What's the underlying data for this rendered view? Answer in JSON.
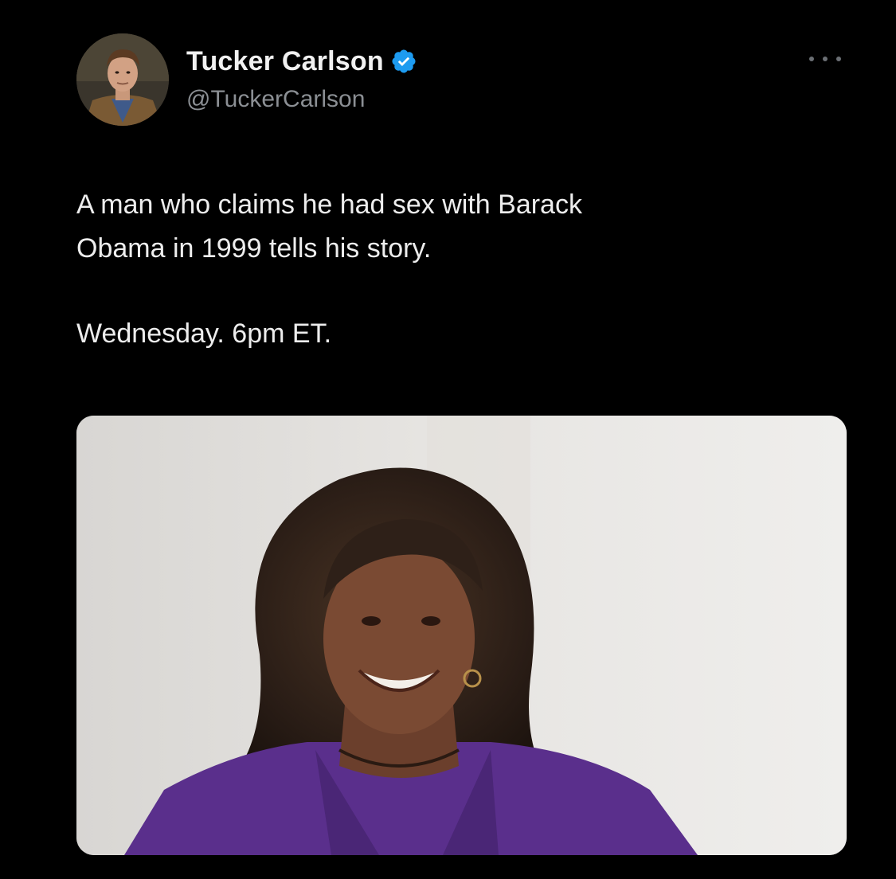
{
  "tweet": {
    "author": {
      "name": "Tucker Carlson",
      "handle": "@TuckerCarlson",
      "verified": true,
      "verified_color": "#1d9bf0"
    },
    "text_line1": "A man who claims he had sex with Barack\nObama in 1999 tells his story.",
    "text_line2": "Wednesday. 6pm ET.",
    "media": {
      "kind": "photo",
      "accent_color": "#5a2f8c"
    },
    "menu_icon": "more-horizontal-icon"
  },
  "colors": {
    "background": "#000000",
    "text": "#ededed",
    "secondary_text": "#8b8f94"
  }
}
